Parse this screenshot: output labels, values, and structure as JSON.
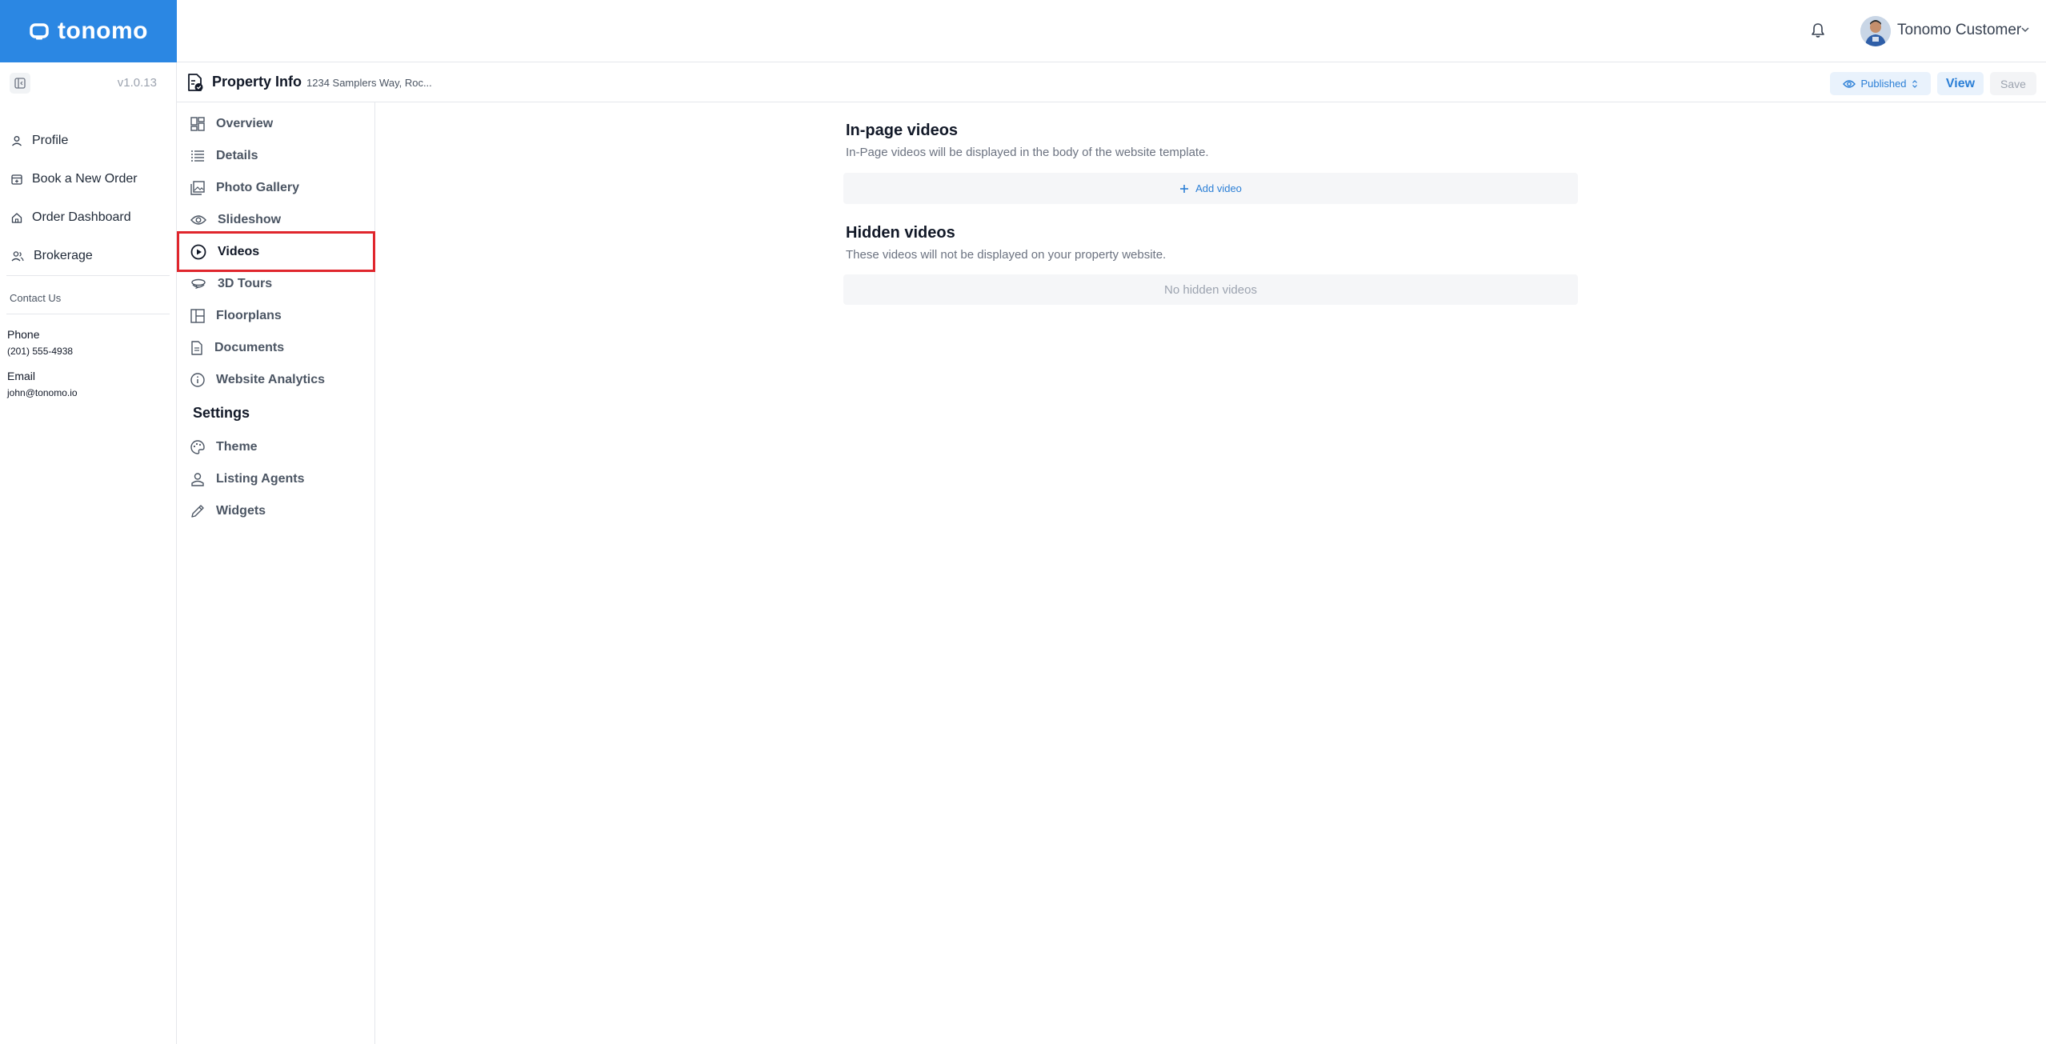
{
  "brand": {
    "name": "tonomo",
    "color": "#2b87e3"
  },
  "topbar": {
    "user_name": "Tonomo Customer",
    "icons": [
      "bell-icon",
      "chevron-down-icon"
    ]
  },
  "sidebar": {
    "version": "v1.0.13",
    "items": [
      {
        "label": "Profile",
        "icon": "user-icon"
      },
      {
        "label": "Book a New Order",
        "icon": "calendar-plus-icon"
      },
      {
        "label": "Order Dashboard",
        "icon": "home-icon"
      },
      {
        "label": "Brokerage",
        "icon": "users-icon"
      }
    ],
    "contact": {
      "title": "Contact Us",
      "phone_label": "Phone",
      "phone": "(201) 555-4938",
      "email_label": "Email",
      "email": "john@tonomo.io"
    }
  },
  "header": {
    "title": "Property Info",
    "address": "1234 Samplers Way, Roc...",
    "status": "Published",
    "view_label": "View",
    "save_label": "Save"
  },
  "subnav": {
    "items": [
      {
        "label": "Overview",
        "icon": "grid-icon"
      },
      {
        "label": "Details",
        "icon": "list-icon"
      },
      {
        "label": "Photo Gallery",
        "icon": "gallery-icon"
      },
      {
        "label": "Slideshow",
        "icon": "eye-icon"
      },
      {
        "label": "Videos",
        "icon": "play-circle-icon",
        "active": true
      },
      {
        "label": "3D Tours",
        "icon": "360-icon"
      },
      {
        "label": "Floorplans",
        "icon": "floorplan-icon"
      },
      {
        "label": "Documents",
        "icon": "document-icon"
      },
      {
        "label": "Website Analytics",
        "icon": "info-icon"
      }
    ],
    "settings_heading": "Settings",
    "settings_items": [
      {
        "label": "Theme",
        "icon": "palette-icon"
      },
      {
        "label": "Listing Agents",
        "icon": "user-icon"
      },
      {
        "label": "Widgets",
        "icon": "pencil-icon"
      }
    ],
    "highlight_color": "#e0262d"
  },
  "main": {
    "inpage": {
      "title": "In-page videos",
      "description": "In-Page videos will be displayed in the body of the website template.",
      "add_label": "Add video"
    },
    "hidden": {
      "title": "Hidden videos",
      "description": "These videos will not be displayed on your property website.",
      "empty_label": "No hidden videos"
    }
  }
}
